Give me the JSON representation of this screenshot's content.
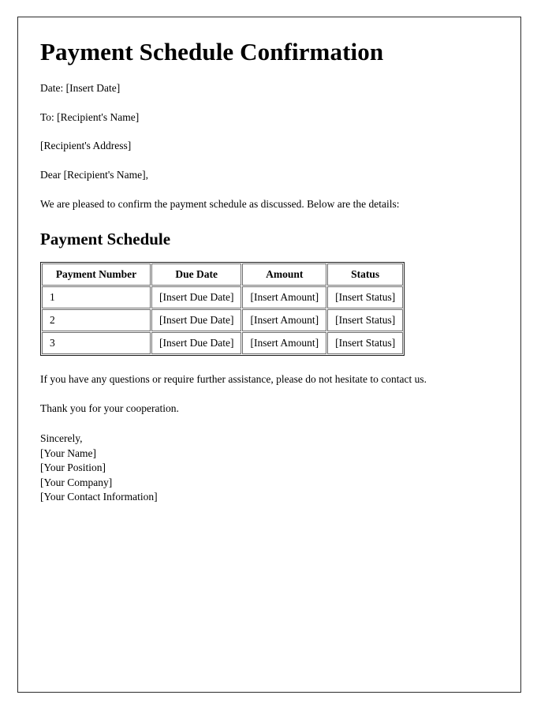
{
  "document": {
    "title": "Payment Schedule Confirmation",
    "date_line": "Date: [Insert Date]",
    "to_line": "To: [Recipient's Name]",
    "address_line": "[Recipient's Address]",
    "salutation": "Dear [Recipient's Name],",
    "intro_paragraph": "We are pleased to confirm the payment schedule as discussed. Below are the details:",
    "section_heading": "Payment Schedule",
    "closing_paragraph": "If you have any questions or require further assistance, please do not hesitate to contact us.",
    "thanks_paragraph": "Thank you for your cooperation.",
    "signature": {
      "closing": "Sincerely,",
      "name": "[Your Name]",
      "position": "[Your Position]",
      "company": "[Your Company]",
      "contact": "[Your Contact Information]"
    }
  },
  "table": {
    "headers": [
      "Payment Number",
      "Due Date",
      "Amount",
      "Status"
    ],
    "rows": [
      {
        "number": "1",
        "due_date": "[Insert Due Date]",
        "amount": "[Insert Amount]",
        "status": "[Insert Status]"
      },
      {
        "number": "2",
        "due_date": "[Insert Due Date]",
        "amount": "[Insert Amount]",
        "status": "[Insert Status]"
      },
      {
        "number": "3",
        "due_date": "[Insert Due Date]",
        "amount": "[Insert Amount]",
        "status": "[Insert Status]"
      }
    ]
  },
  "colors": {
    "page_border": "#2b2b2b",
    "table_border": "#1a1a1a",
    "cell_border": "#6e6e6e",
    "text": "#000000",
    "background": "#ffffff"
  }
}
